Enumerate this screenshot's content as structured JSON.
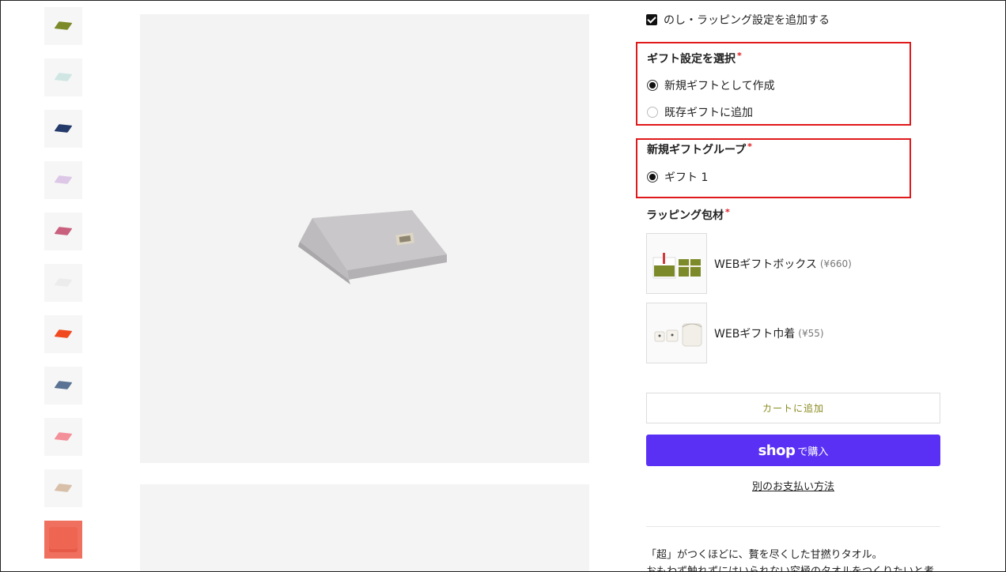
{
  "thumbnails": [
    {
      "color": "#7d8a2a"
    },
    {
      "color": "#cfe6e3"
    },
    {
      "color": "#243a6b"
    },
    {
      "color": "#dcc7e6"
    },
    {
      "color": "#c8607e"
    },
    {
      "color": "#ececec"
    },
    {
      "color": "#f04a1e"
    },
    {
      "color": "#5a7394"
    },
    {
      "color": "#f4909a"
    },
    {
      "color": "#d8bfa8"
    },
    {
      "color": "#ee6652"
    }
  ],
  "gift": {
    "checkbox_label": "のし・ラッピング設定を追加する",
    "select_title": "ギフト設定を選択",
    "required_mark": "*",
    "option_new": "新規ギフトとして作成",
    "option_existing": "既存ギフトに追加",
    "group_title": "新規ギフトグループ",
    "group_option": "ギフト 1"
  },
  "wrapping": {
    "title": "ラッピング包材",
    "items": [
      {
        "label": "WEBギフトボックス",
        "price": "(¥660)"
      },
      {
        "label": "WEBギフト巾着",
        "price": "(¥55)"
      }
    ]
  },
  "actions": {
    "add_to_cart": "カートに追加",
    "shop_logo": "shop",
    "shop_buy": "で購入",
    "other_payment": "別のお支払い方法"
  },
  "description": {
    "line1": "「超」がつくほどに、贅を尽くした甘撚りタオル。",
    "line2": "おもわず触れずにはいられない究極のタオルをつくりたいと考"
  },
  "colors": {
    "accent_red": "#e0191b",
    "shop_purple": "#5a31f4",
    "cart_text": "#8a8a1f"
  }
}
